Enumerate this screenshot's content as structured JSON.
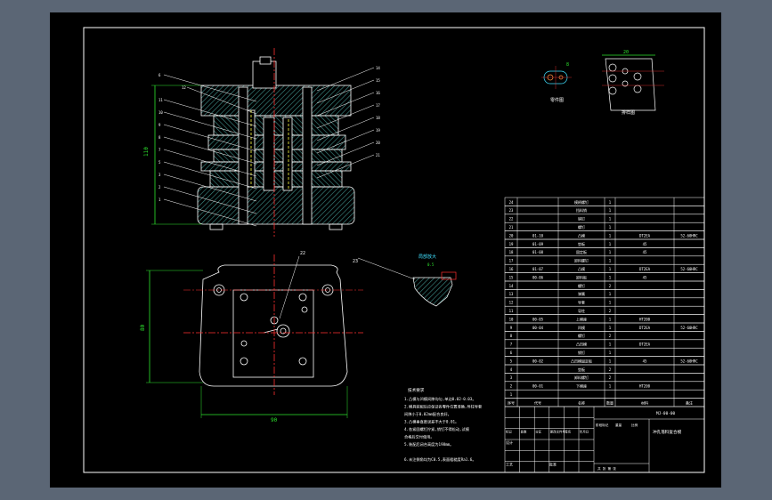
{
  "colors": {
    "background": "#5b6675",
    "canvas": "#000000",
    "line": "#ffffff",
    "hatch": "#3f8f8a",
    "center": "#ff3030",
    "dim": "#2ee62e",
    "hidden": "#ffff40",
    "cyan": "#40e0ff"
  },
  "drawing": {
    "part_title": "零件图",
    "strip_title": "排样图",
    "detail_title": "局部放大",
    "part_dim": "8",
    "detail_dim": "0.5",
    "strip_dim": "20",
    "dim_side_height": "110",
    "dim_side_width": "80",
    "dim_bottom_width": "90",
    "section_leaders": [
      "6",
      "12",
      "11",
      "10",
      "9",
      "8",
      "7",
      "5",
      "3",
      "2",
      "1"
    ],
    "section_leaders_right": [
      "14",
      "15",
      "16",
      "17",
      "18",
      "19",
      "20",
      "21"
    ],
    "plan_leader": "22",
    "detail_leader": "23"
  },
  "notes": {
    "heading": "技术要求",
    "lines": [
      "1.凸模与凹模间隙均匀,单边0.02-0.03。",
      "2.模具装配后应保证各零件位置准确,导柱导套",
      "  间隙小于0.02mm配合良好。",
      "3.凸模垂直度误差不大于0.01。",
      "4.各紧固螺钉拧紧,销钉不得松动,试模",
      "  合格后交付使用。",
      "5.装配后闭合高度为198mm。",
      "",
      "6.未注倒角均为C0.5,表面粗糙度Ra1.6。"
    ]
  },
  "bom": [
    {
      "no": "24",
      "code": "",
      "name": "模柄螺钉",
      "qty": "1",
      "material": "",
      "note": ""
    },
    {
      "no": "23",
      "code": "",
      "name": "挡料销",
      "qty": "1",
      "material": "",
      "note": ""
    },
    {
      "no": "22",
      "code": "",
      "name": "销钉",
      "qty": "1",
      "material": "",
      "note": ""
    },
    {
      "no": "21",
      "code": "",
      "name": "螺钉",
      "qty": "1",
      "material": "",
      "note": ""
    },
    {
      "no": "20",
      "code": "01-10",
      "name": "凸模",
      "qty": "1",
      "material": "DT2EA",
      "note": "52-60HRC"
    },
    {
      "no": "19",
      "code": "01-09",
      "name": "垫板",
      "qty": "1",
      "material": "45",
      "note": ""
    },
    {
      "no": "18",
      "code": "01-08",
      "name": "固定板",
      "qty": "1",
      "material": "45",
      "note": ""
    },
    {
      "no": "17",
      "code": "",
      "name": "卸料螺钉",
      "qty": "1",
      "material": "",
      "note": ""
    },
    {
      "no": "16",
      "code": "01-07",
      "name": "凸模",
      "qty": "1",
      "material": "DT2EA",
      "note": "52-60HRC"
    },
    {
      "no": "15",
      "code": "00-06",
      "name": "卸料板",
      "qty": "1",
      "material": "45",
      "note": ""
    },
    {
      "no": "14",
      "code": "",
      "name": "螺钉",
      "qty": "2",
      "material": "",
      "note": ""
    },
    {
      "no": "13",
      "code": "",
      "name": "弹簧",
      "qty": "1",
      "material": "",
      "note": ""
    },
    {
      "no": "12",
      "code": "",
      "name": "导套",
      "qty": "1",
      "material": "",
      "note": ""
    },
    {
      "no": "11",
      "code": "",
      "name": "导柱",
      "qty": "2",
      "material": "",
      "note": ""
    },
    {
      "no": "10",
      "code": "00-05",
      "name": "上模座",
      "qty": "1",
      "material": "HT200",
      "note": ""
    },
    {
      "no": "9",
      "code": "00-04",
      "name": "凹模",
      "qty": "1",
      "material": "DT2EA",
      "note": "52-60HRC"
    },
    {
      "no": "8",
      "code": "",
      "name": "螺钉",
      "qty": "2",
      "material": "",
      "note": ""
    },
    {
      "no": "7",
      "code": "",
      "name": "凸凹模",
      "qty": "1",
      "material": "DT2EA",
      "note": ""
    },
    {
      "no": "6",
      "code": "",
      "name": "销钉",
      "qty": "1",
      "material": "",
      "note": ""
    },
    {
      "no": "5",
      "code": "00-02",
      "name": "凸凹模固定板",
      "qty": "1",
      "material": "45",
      "note": "52-60HRC"
    },
    {
      "no": "4",
      "code": "",
      "name": "垫板",
      "qty": "2",
      "material": "",
      "note": ""
    },
    {
      "no": "3",
      "code": "",
      "name": "卸料螺钉",
      "qty": "2",
      "material": "",
      "note": ""
    },
    {
      "no": "2",
      "code": "00-01",
      "name": "下模座",
      "qty": "1",
      "material": "HT200",
      "note": ""
    },
    {
      "no": "1",
      "code": "",
      "name": "",
      "qty": "",
      "material": "",
      "note": ""
    }
  ],
  "bom_header": {
    "no": "序号",
    "code": "代号",
    "name": "名称",
    "qty": "数量",
    "material": "材料",
    "note": "备注"
  },
  "titleblock": {
    "drawing_no": "MJ-00-00",
    "title": "冲孔落料复合模",
    "row_labels": [
      "标记",
      "处数",
      "分区",
      "更改文件号",
      "签名",
      "年月日"
    ],
    "design": "设计",
    "process": "工艺",
    "approve": "批准",
    "stage": "阶段标记",
    "weight": "重量",
    "scale": "比例",
    "sheet": "共 张 第 张"
  }
}
